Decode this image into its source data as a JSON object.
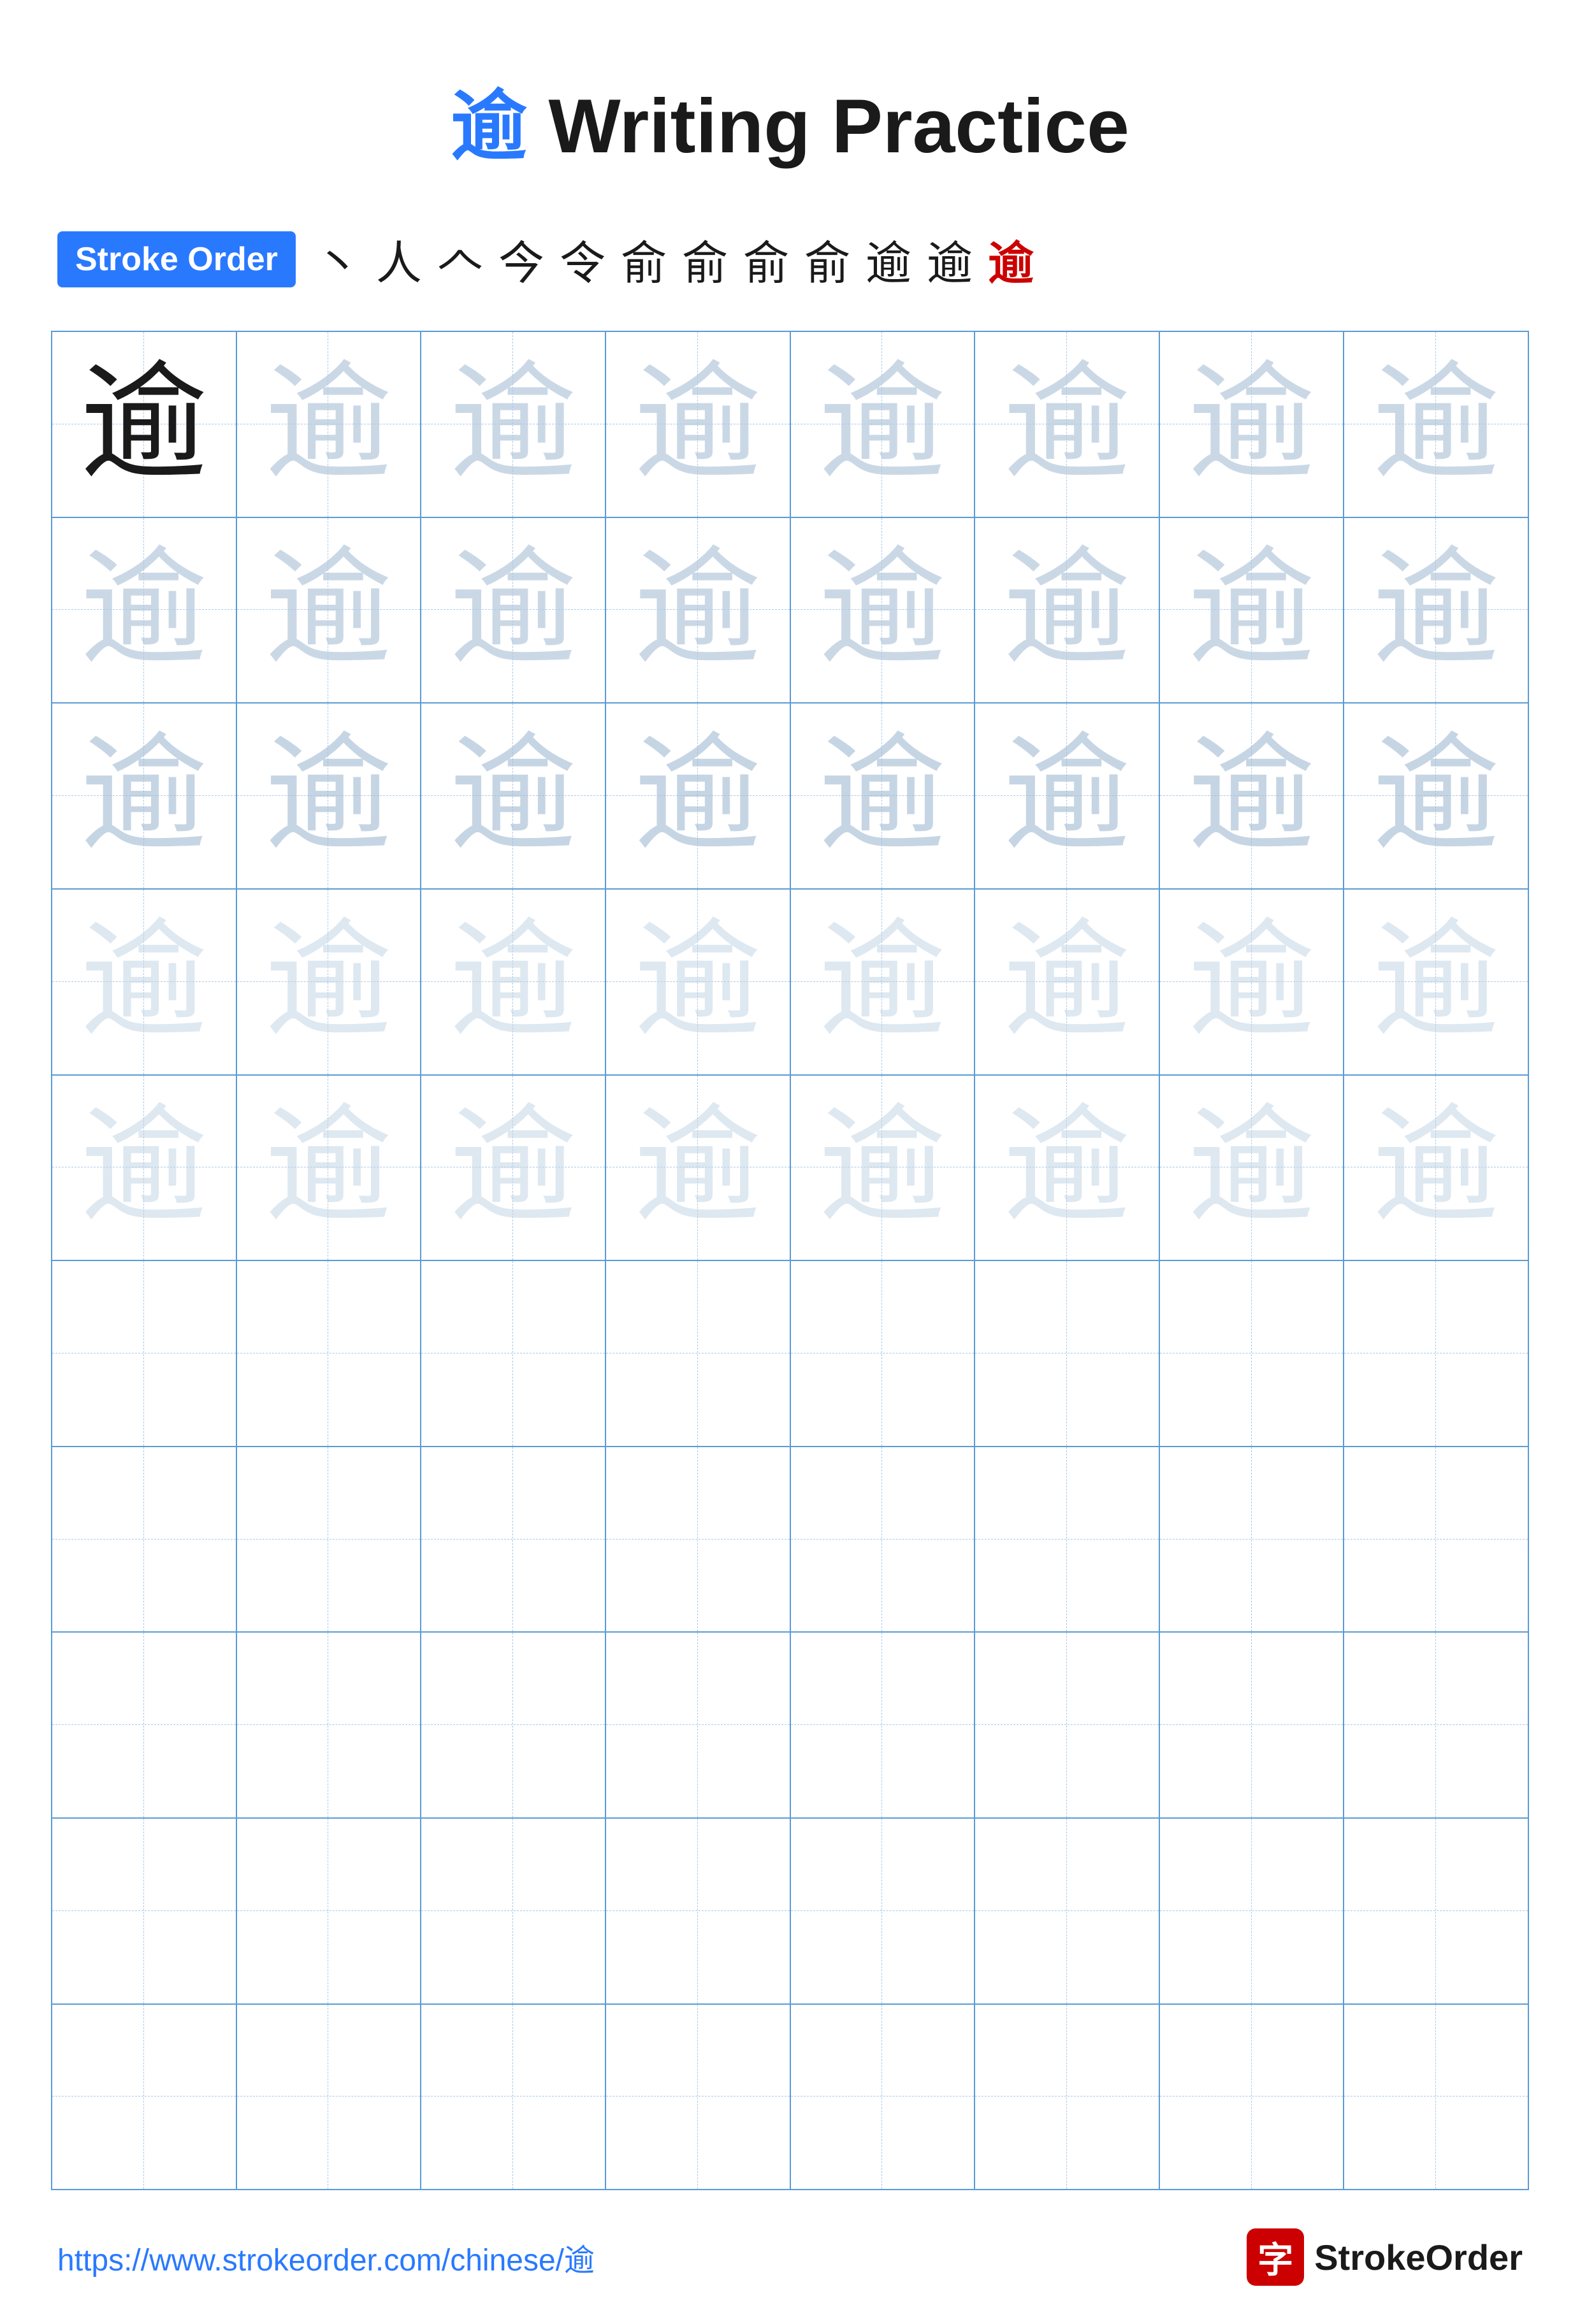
{
  "title": {
    "char": "逾",
    "suffix": " Writing Practice"
  },
  "stroke_order": {
    "badge_label": "Stroke Order",
    "strokes": [
      "丶",
      "人",
      "𠆢",
      "今",
      "令",
      "俞",
      "俞",
      "俞",
      "俞",
      "逾",
      "逾",
      "逾"
    ]
  },
  "grid": {
    "rows": 10,
    "cols": 8,
    "practice_char": "逾",
    "guide_rows": 5,
    "empty_rows": 5
  },
  "footer": {
    "url": "https://www.strokeorder.com/chinese/逾",
    "brand_char": "字",
    "brand_name": "StrokeOrder"
  }
}
